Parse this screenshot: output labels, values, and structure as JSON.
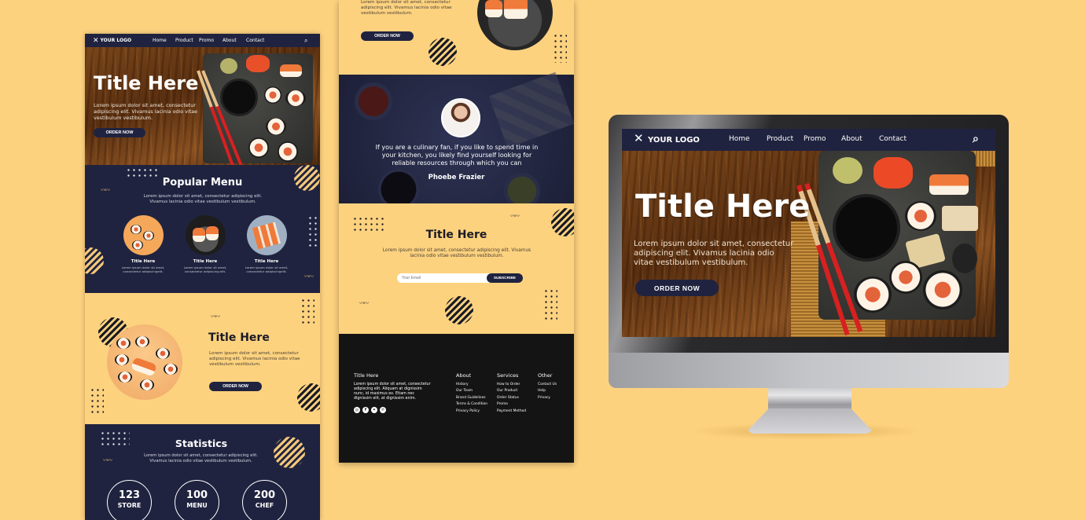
{
  "brand": {
    "logo_text": "YOUR LOGO",
    "accent": "#20233f",
    "background": "#fdd27f",
    "gold": "#f3c77a"
  },
  "nav": {
    "items": [
      "Home",
      "Product",
      "Promo",
      "About",
      "Contact"
    ],
    "search_icon": "search-icon"
  },
  "hero": {
    "title": "Title Here",
    "body": "Lorem ipsum dolor sit amet, consectetur adipiscing elit. Vivamus lacinia odio vitae vestibulum vestibulum.",
    "cta": "ORDER NOW"
  },
  "popular": {
    "title": "Popular Menu",
    "body": "Lorem ipsum dolor sit amet, consectetur adipiscing elit. Vivamus lacinia odio vitae vestibulum vestibulum.",
    "items": [
      {
        "title": "Title Here",
        "body": "Lorem ipsum dolor sit amet, consectetur adipiscingelit."
      },
      {
        "title": "Title Here",
        "body": "Lorem ipsum dolor sit amet, consectetur adipiscing elit."
      },
      {
        "title": "Title Here",
        "body": "Lorem ipsum dolor sit amet, consectetur adipiscingelit."
      }
    ]
  },
  "feature": {
    "title": "Title Here",
    "body": "Lorem ipsum dolor sit amet, consectetur adipiscing elit. Vivamus lacinia odio vitae vestibulum vestibulum.",
    "cta": "ORDER NOW"
  },
  "stats": {
    "title": "Statistics",
    "body": "Lorem ipsum dolor sit amet, consectetur adipiscing elit. Vivamus lacinia odio vitae vestibulum vestibulum.",
    "items": [
      {
        "value": "123",
        "label": "STORE"
      },
      {
        "value": "100",
        "label": "MENU"
      },
      {
        "value": "200",
        "label": "CHEF"
      }
    ]
  },
  "middle_top": {
    "body": "Lorem ipsum dolor sit amet, consectetur adipiscing elit. Vivamus lacinia odio vitae vestibulum vestibulum.",
    "cta": "ORDER NOW"
  },
  "testimonial": {
    "quote": "If you are a culinary fan, if you like to spend time in your kitchen, you likely find yourself looking for reliable resources through which you can",
    "name": "Phoebe Frazier"
  },
  "newsletter": {
    "title": "Title Here",
    "body": "Lorem ipsum dolor sit amet, consectetur adipiscing elit. Vivamus lacinia odio vitae vestibulum vestibulum.",
    "email_placeholder": "Your Email",
    "subscribe": "SUBSCRIBE"
  },
  "footer": {
    "title": "Title Here",
    "body": "Lorem ipsum dolor sit amet, consectetur adipiscing elit. Aliquam at dignissim nunc, id maximus ex. Etiam nec dignissim elit, at dignissim enim.",
    "social": [
      "instagram-icon",
      "facebook-icon",
      "twitter-icon",
      "pinterest-icon"
    ],
    "columns": [
      {
        "title": "About",
        "links": [
          "History",
          "Our Team",
          "Brand Guidelines",
          "Terms & Condition",
          "Privacy Policy"
        ]
      },
      {
        "title": "Services",
        "links": [
          "How to Order",
          "Our Product",
          "Order Status",
          "Promo",
          "Payment Method"
        ]
      },
      {
        "title": "Other",
        "links": [
          "Contact Us",
          "Help",
          "Privacy"
        ]
      }
    ]
  }
}
